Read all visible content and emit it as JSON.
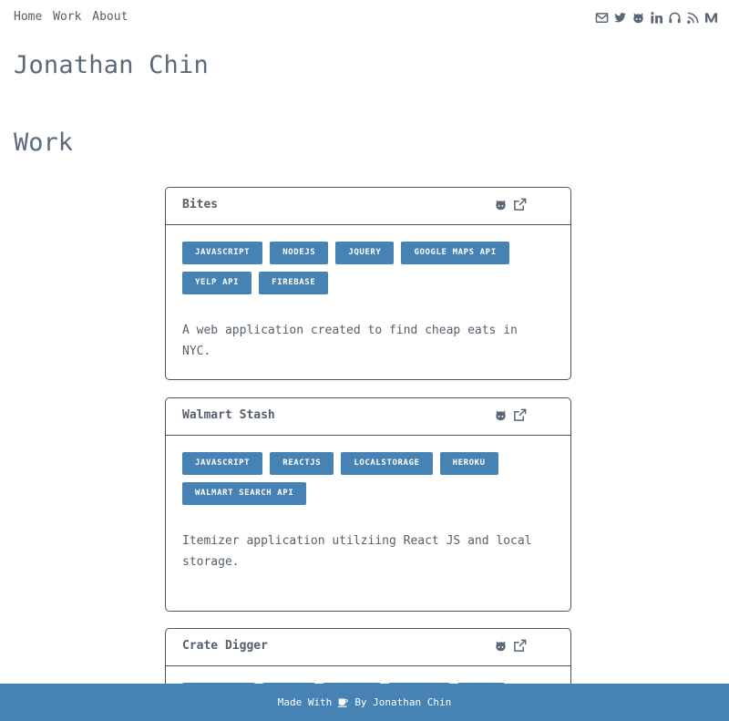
{
  "nav": {
    "links": [
      "Home",
      "Work",
      "About"
    ]
  },
  "social": [
    "envelope-icon",
    "twitter-icon",
    "github-icon",
    "linkedin-icon",
    "headphones-icon",
    "rss-icon",
    "medium-icon"
  ],
  "site_title": "Jonathan Chin",
  "section_title": "Work",
  "projects": [
    {
      "title": "Bites",
      "tags": [
        "JAVASCRIPT",
        "NODEJS",
        "JQUERY",
        "GOOGLE MAPS API",
        "YELP API",
        "FIREBASE"
      ],
      "description": "A web application created to find cheap eats in NYC."
    },
    {
      "title": "Walmart Stash",
      "tags": [
        "JAVASCRIPT",
        "REACTJS",
        "LOCALSTORAGE",
        "HEROKU",
        "WALMART SEARCH API"
      ],
      "description": "Itemizer application utilziing React JS and local storage."
    },
    {
      "title": "Crate Digger",
      "tags": [
        "",
        "",
        "",
        "",
        ""
      ],
      "description": ""
    }
  ],
  "footer": {
    "made_with": "Made With",
    "by": "By Jonathan Chin"
  },
  "colors": {
    "accent": "#4682b4",
    "text": "#55606b",
    "border": "#4a5560"
  }
}
